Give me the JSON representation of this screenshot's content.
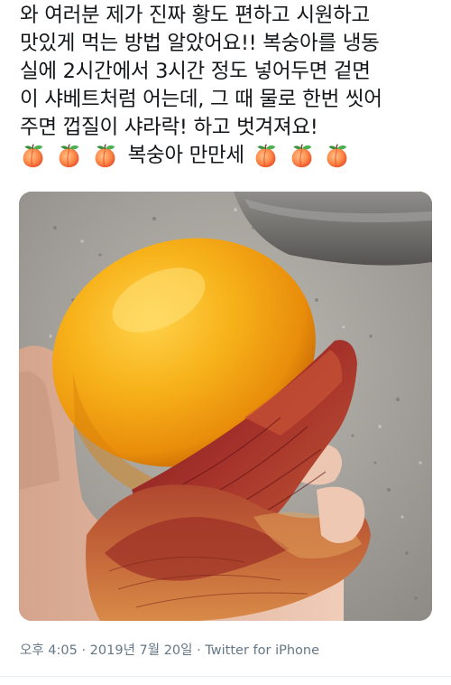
{
  "tweet": {
    "text_lines": [
      "와 여러분 제가 진짜 황도 편하고 시원하고",
      "맛있게 먹는 방법 알았어요!! 복숭아를 냉동",
      "실에 2시간에서 3시간 정도 넣어두면 겉면",
      "이 샤베트처럼 어는데, 그 때 물로 한번 씻어",
      "주면 껍질이 샤라락! 하고 벗겨져요!"
    ],
    "emoji_line": {
      "leading_emoji_count": 3,
      "text": "복숭아 만만세",
      "trailing_emoji_count": 3,
      "emoji_icon": "peach-emoji"
    },
    "photo": {
      "subject": "peeled-yellow-peach-photo"
    },
    "timestamp": "오후 4:05 · 2019년 7월 20일 · ",
    "source": "Twitter for iPhone"
  },
  "colors": {
    "text": "#14171a",
    "meta": "#657786",
    "divider": "#e6ecf0"
  }
}
